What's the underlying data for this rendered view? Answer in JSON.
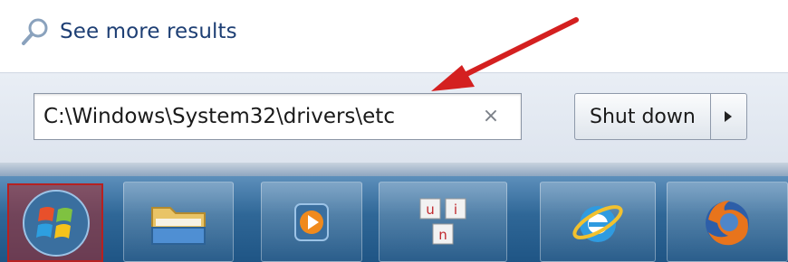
{
  "start_menu": {
    "see_more_label": "See more results",
    "search": {
      "value": "C:\\Windows\\System32\\drivers\\etc",
      "clear_glyph": "×"
    },
    "shutdown": {
      "label": "Shut down",
      "arrow_icon": "play-triangle-icon"
    }
  },
  "taskbar": {
    "items": [
      {
        "name": "start-orb",
        "icon": "windows-logo-icon"
      },
      {
        "name": "file-explorer",
        "icon": "folder-icon"
      },
      {
        "name": "media-player",
        "icon": "media-player-icon"
      },
      {
        "name": "uni-app",
        "icon": "uni-tiles-icon",
        "tiles": [
          "u",
          "i",
          "n"
        ]
      },
      {
        "name": "internet-explorer",
        "icon": "internet-explorer-icon"
      },
      {
        "name": "firefox",
        "icon": "firefox-icon"
      }
    ]
  },
  "colors": {
    "link": "#1e3f74",
    "annotation_arrow": "#d42020",
    "taskbar": "#2f6797",
    "highlight": "#b62121"
  }
}
